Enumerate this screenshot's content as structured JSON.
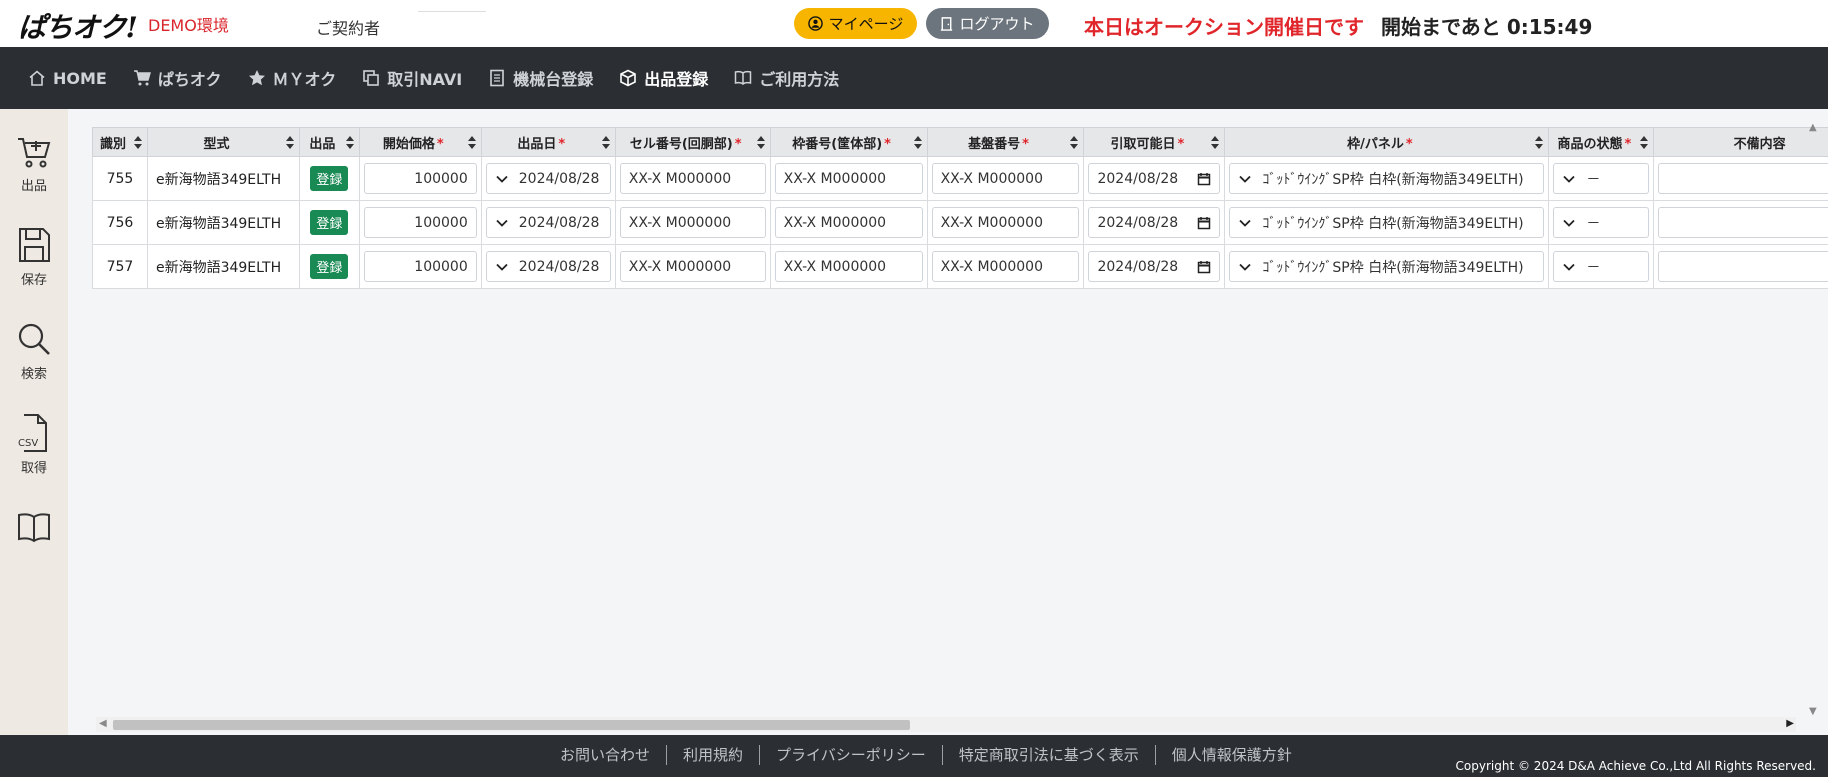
{
  "header": {
    "logo": "ぱちオク!",
    "demo_label": "DEMO環境",
    "contract_label": "ご契約者",
    "mypage_label": "マイページ",
    "logout_label": "ログアウト",
    "auction_message": "本日はオークション開催日です",
    "countdown_label": "開始まであと",
    "countdown_value": "0:15:49"
  },
  "nav": {
    "items": [
      {
        "label": "HOME",
        "icon": "home-icon"
      },
      {
        "label": "ぱちオク",
        "icon": "cart-icon"
      },
      {
        "label": "ＭＹオク",
        "icon": "star-icon"
      },
      {
        "label": "取引NAVI",
        "icon": "copy-icon"
      },
      {
        "label": "機械台登録",
        "icon": "book-icon"
      },
      {
        "label": "出品登録",
        "icon": "box-icon"
      },
      {
        "label": "ご利用方法",
        "icon": "open-book-icon"
      }
    ],
    "active": "出品登録"
  },
  "sidebar": {
    "items": [
      {
        "label": "出品",
        "icon": "cart-plus-icon"
      },
      {
        "label": "保存",
        "icon": "save-icon"
      },
      {
        "label": "検索",
        "icon": "search-icon"
      },
      {
        "label": "取得",
        "icon": "csv-icon",
        "icon_text": "CSV"
      },
      {
        "label": "",
        "icon": "book-icon"
      }
    ]
  },
  "table": {
    "columns": [
      {
        "label": "識別",
        "required": false
      },
      {
        "label": "型式",
        "required": false
      },
      {
        "label": "出品",
        "required": false
      },
      {
        "label": "開始価格",
        "required": true
      },
      {
        "label": "出品日",
        "required": true
      },
      {
        "label": "セル番号(回胴部)",
        "required": true
      },
      {
        "label": "枠番号(筐体部)",
        "required": true
      },
      {
        "label": "基盤番号",
        "required": true
      },
      {
        "label": "引取可能日",
        "required": true
      },
      {
        "label": "枠/パネル",
        "required": true
      },
      {
        "label": "商品の状態",
        "required": true
      },
      {
        "label": "不備内容",
        "required": false
      }
    ],
    "register_label": "登録",
    "rows": [
      {
        "id": "755",
        "model": "e新海物語349ELTH",
        "price": "100000",
        "date": "2024/08/28",
        "cell": "XX-X M000000",
        "frame": "XX-X M000000",
        "board": "XX-X M000000",
        "pickup": "2024/08/28",
        "panel": "ｺﾞｯﾄﾞｳｲﾝｸﾞSP枠 白枠(新海物語349ELTH)",
        "condition": "－",
        "defect": ""
      },
      {
        "id": "756",
        "model": "e新海物語349ELTH",
        "price": "100000",
        "date": "2024/08/28",
        "cell": "XX-X M000000",
        "frame": "XX-X M000000",
        "board": "XX-X M000000",
        "pickup": "2024/08/28",
        "panel": "ｺﾞｯﾄﾞｳｲﾝｸﾞSP枠 白枠(新海物語349ELTH)",
        "condition": "－",
        "defect": ""
      },
      {
        "id": "757",
        "model": "e新海物語349ELTH",
        "price": "100000",
        "date": "2024/08/28",
        "cell": "XX-X M000000",
        "frame": "XX-X M000000",
        "board": "XX-X M000000",
        "pickup": "2024/08/28",
        "panel": "ｺﾞｯﾄﾞｳｲﾝｸﾞSP枠 白枠(新海物語349ELTH)",
        "condition": "－",
        "defect": ""
      }
    ]
  },
  "footer": {
    "links": [
      "お問い合わせ",
      "利用規約",
      "プライバシーポリシー",
      "特定商取引法に基づく表示",
      "個人情報保護方針"
    ],
    "copyright": "Copyright © 2024 D&A Achieve Co.,Ltd All Rights Reserved."
  },
  "colors": {
    "accent_yellow": "#f7b500",
    "alert_red": "#e0262b",
    "nav_dark": "#2b2f33",
    "register_green": "#1a8a55",
    "sidebar_beige": "#eee9e2"
  }
}
